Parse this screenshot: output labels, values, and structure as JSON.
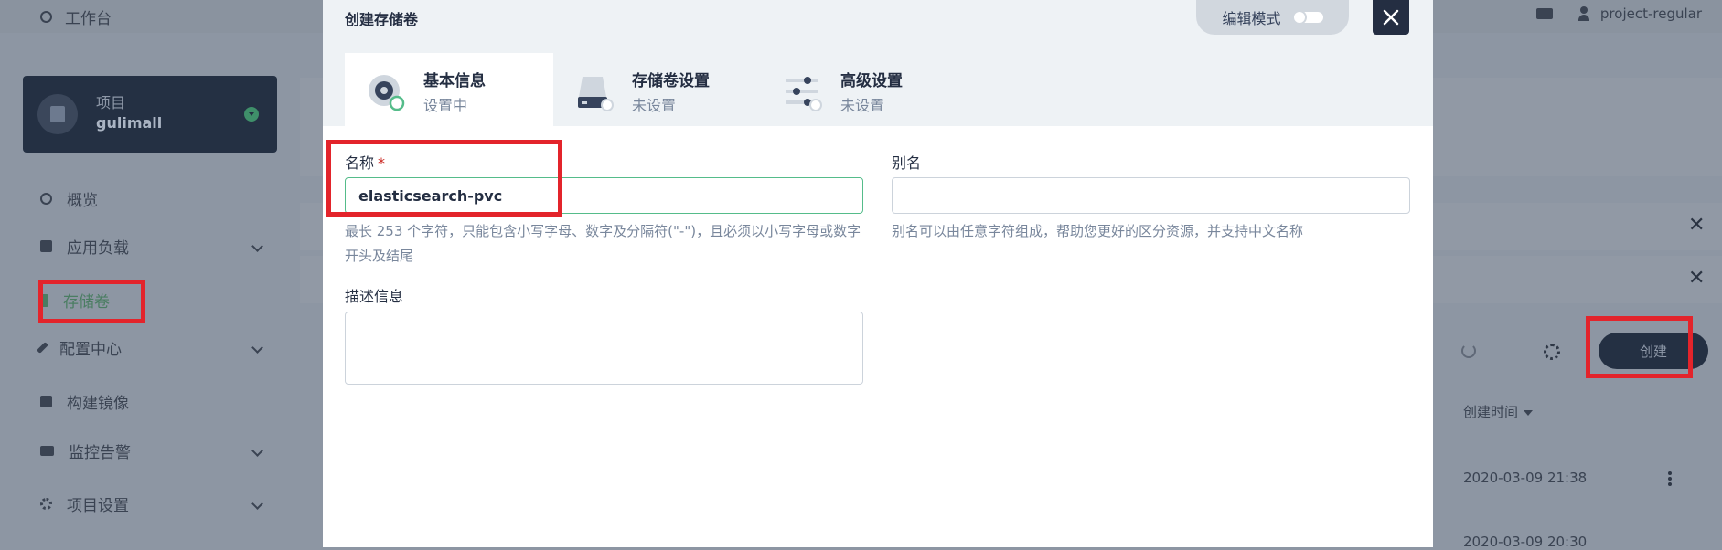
{
  "topbar": {
    "workbench_label": "工作台",
    "user_label": "project-regular"
  },
  "sidebar": {
    "project_card": {
      "label": "项目",
      "name": "gulimall"
    },
    "items": [
      {
        "label": "概览",
        "icon": "dashboard-icon",
        "has_children": false
      },
      {
        "label": "应用负载",
        "icon": "layers-icon",
        "has_children": true
      },
      {
        "label": "存储卷",
        "icon": "storage-icon",
        "has_children": false,
        "active": true
      },
      {
        "label": "配置中心",
        "icon": "wrench-icon",
        "has_children": true
      },
      {
        "label": "构建镜像",
        "icon": "image-icon",
        "has_children": false
      },
      {
        "label": "监控告警",
        "icon": "monitor-icon",
        "has_children": true
      },
      {
        "label": "项目设置",
        "icon": "gear-icon",
        "has_children": true
      }
    ]
  },
  "background_table": {
    "create_label": "创建",
    "column_created_time": "创建时间",
    "row1_time": "2020-03-09 21:38",
    "row2_time": "2020-03-09 20:30"
  },
  "modal": {
    "title": "创建存储卷",
    "edit_mode_label": "编辑模式",
    "tabs": [
      {
        "label": "基本信息",
        "status": "设置中",
        "icon": "basic-info-icon"
      },
      {
        "label": "存储卷设置",
        "status": "未设置",
        "icon": "disk-icon"
      },
      {
        "label": "高级设置",
        "status": "未设置",
        "icon": "sliders-icon"
      }
    ],
    "form": {
      "name_label": "名称",
      "name_required_mark": "*",
      "name_value": "elasticsearch-pvc",
      "name_hint": "最长 253 个字符，只能包含小写字母、数字及分隔符(\"-\")，且必须以小写字母或数字开头及结尾",
      "alias_label": "别名",
      "alias_value": "",
      "alias_hint": "别名可以由任意字符组成，帮助您更好的区分资源，并支持中文名称",
      "desc_label": "描述信息",
      "desc_value": ""
    }
  },
  "colors": {
    "accent_green": "#55bc8a",
    "dark_navy": "#242e42",
    "highlight_red": "#e3242b"
  }
}
